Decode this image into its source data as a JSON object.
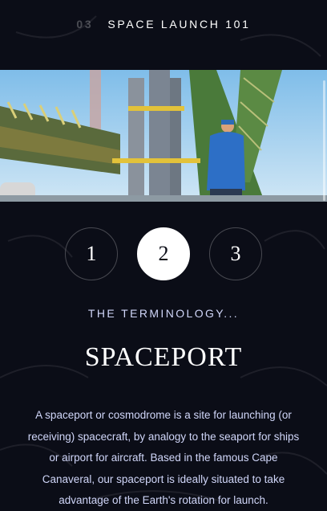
{
  "header": {
    "number": "03",
    "title": "SPACE LAUNCH 101"
  },
  "hero": {
    "image_name": "spaceport-launch-pad-photo"
  },
  "steps": {
    "items": [
      "1",
      "2",
      "3"
    ],
    "active": "2"
  },
  "content": {
    "kicker": "THE TERMINOLOGY...",
    "heading": "SPACEPORT",
    "body": "A spaceport or cosmodrome is a site for launching (or receiving) spacecraft, by analogy to the seaport for ships or airport for aircraft. Based in the famous Cape Canaveral, our spaceport is ideally situated to take advantage of the Earth's rotation for launch."
  },
  "colors": {
    "background": "#0b0d17",
    "text_light": "#d0d6f9",
    "white": "#ffffff"
  }
}
